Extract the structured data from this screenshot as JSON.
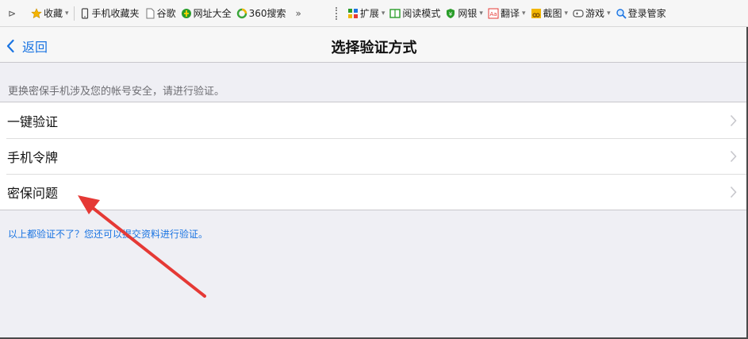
{
  "browser_toolbar": {
    "favorites": "收藏",
    "mobile_favorites": "手机收藏夹",
    "google": "谷歌",
    "site_nav": "网址大全",
    "search360": "360搜索",
    "more": "»",
    "extensions": "扩展",
    "reading_mode": "阅读模式",
    "banking": "网银",
    "translate": "翻译",
    "screenshot": "截图",
    "games": "游戏",
    "login_manager": "登录管家"
  },
  "nav": {
    "back_label": "返回",
    "title": "选择验证方式"
  },
  "hint_text": "更换密保手机涉及您的帐号安全，请进行验证。",
  "options": [
    {
      "label": "一键验证"
    },
    {
      "label": "手机令牌"
    },
    {
      "label": "密保问题"
    }
  ],
  "help_link": "以上都验证不了？您还可以提交资料进行验证。",
  "colors": {
    "accent": "#1a74e2",
    "annotation_arrow": "#e53935",
    "page_background": "#efeff4"
  }
}
